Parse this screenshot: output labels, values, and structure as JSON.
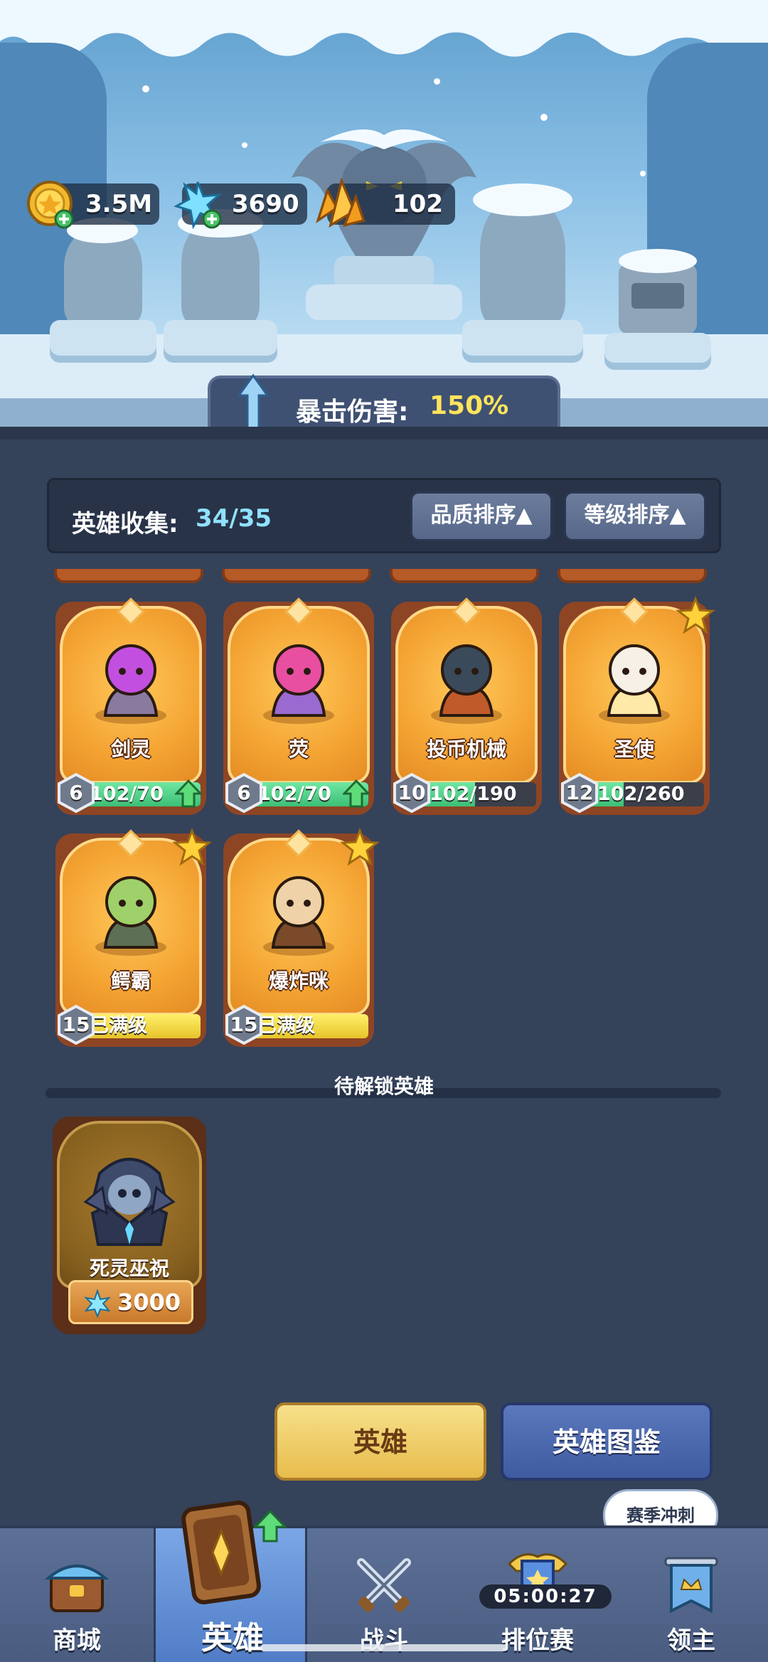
{
  "currencies": {
    "gold": {
      "value": "3.5M",
      "icon": "gold-coin-icon"
    },
    "crystal": {
      "value": "3690",
      "icon": "ice-crystal-icon"
    },
    "shard": {
      "value": "102",
      "icon": "orange-shard-icon"
    }
  },
  "crit": {
    "label": "暴击伤害:",
    "value": "150%"
  },
  "collection": {
    "label": "英雄收集:",
    "value": "34/35"
  },
  "sort": {
    "quality": "品质排序▲",
    "level": "等级排序▲"
  },
  "heroes": [
    {
      "name": "剑灵",
      "level": "6",
      "progress": "102/70",
      "fill": 1.0,
      "upgradable": true,
      "starred": false,
      "maxed": false
    },
    {
      "name": "荧",
      "level": "6",
      "progress": "102/70",
      "fill": 1.0,
      "upgradable": true,
      "starred": false,
      "maxed": false
    },
    {
      "name": "投币机械",
      "level": "10",
      "progress": "102/190",
      "fill": 0.54,
      "upgradable": false,
      "starred": false,
      "maxed": false
    },
    {
      "name": "圣使",
      "level": "12",
      "progress": "102/260",
      "fill": 0.39,
      "upgradable": false,
      "starred": true,
      "maxed": false
    },
    {
      "name": "鳄霸",
      "level": "15",
      "progress": "已满级",
      "fill": 1.0,
      "upgradable": false,
      "starred": true,
      "maxed": true
    },
    {
      "name": "爆炸咪",
      "level": "15",
      "progress": "已满级",
      "fill": 1.0,
      "upgradable": false,
      "starred": true,
      "maxed": true
    }
  ],
  "locked_section": {
    "title": "待解锁英雄"
  },
  "locked_heroes": [
    {
      "name": "死灵巫祝",
      "price": "3000",
      "price_icon": "ice-crystal-icon"
    }
  ],
  "buttons": {
    "hero": "英雄",
    "codex": "英雄图鉴"
  },
  "bubble": "赛季冲刺",
  "nav": {
    "items": [
      {
        "label": "商城",
        "icon": "shop-chest-icon"
      },
      {
        "label": "英雄",
        "icon": "hero-card-icon",
        "active": true
      },
      {
        "label": "战斗",
        "icon": "crossed-swords-icon"
      },
      {
        "label": "排位赛",
        "icon": "ranked-shield-icon"
      },
      {
        "label": "领主",
        "icon": "lord-banner-icon"
      }
    ],
    "timer": "05:00:27"
  }
}
